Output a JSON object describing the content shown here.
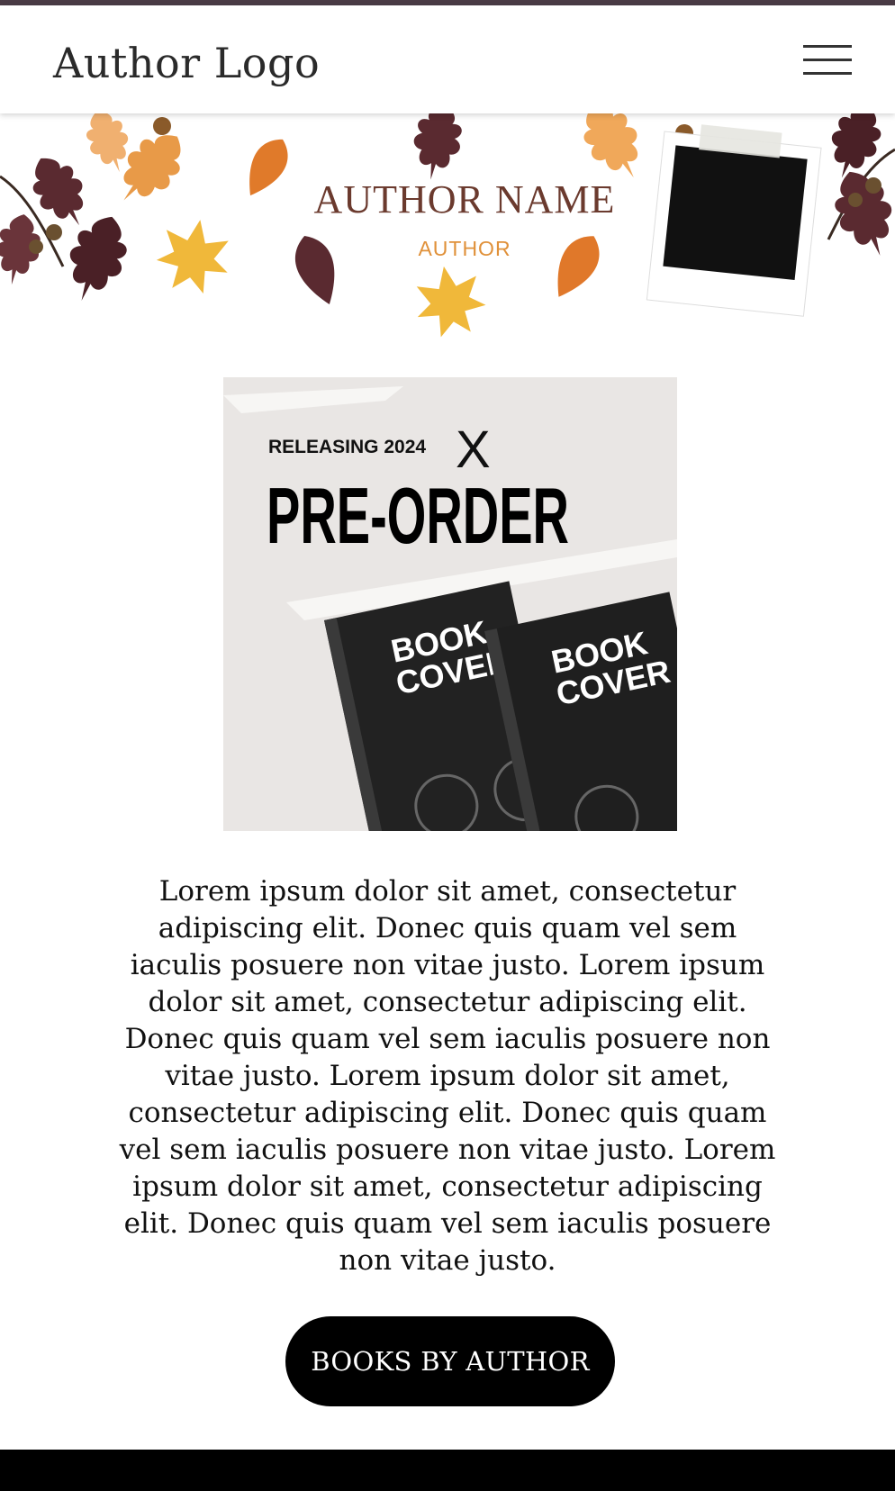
{
  "header": {
    "logo_text": "Author Logo",
    "menu_icon": "hamburger-menu-icon"
  },
  "banner": {
    "author_name": "AUTHOR NAME",
    "author_role": "AUTHOR",
    "decoration": "autumn-leaves",
    "name_color": "#6b3a2e",
    "role_color": "#e0913a"
  },
  "promo": {
    "kicker": "RELEASING 2024",
    "headline": "PRE-ORDER",
    "book_cover_text_line1": "BOOK",
    "book_cover_text_line2": "COVER",
    "book_cover_count": 2
  },
  "main": {
    "paragraph": "Lorem ipsum dolor sit amet, consectetur adipiscing elit. Donec quis quam vel sem iaculis posuere non vitae justo. Lorem ipsum dolor sit amet, consectetur adipiscing elit. Donec quis quam vel sem iaculis posuere non vitae justo. Lorem ipsum dolor sit amet, consectetur adipiscing elit. Donec quis quam vel sem iaculis posuere non vitae justo. Lorem ipsum dolor sit amet, consectetur adipiscing elit. Donec quis quam vel sem iaculis posuere non vitae justo.",
    "cta_label": "BOOKS BY AUTHOR"
  },
  "colors": {
    "top_accent": "#4a3b45",
    "button_bg": "#000000",
    "footer_bg": "#000000"
  }
}
